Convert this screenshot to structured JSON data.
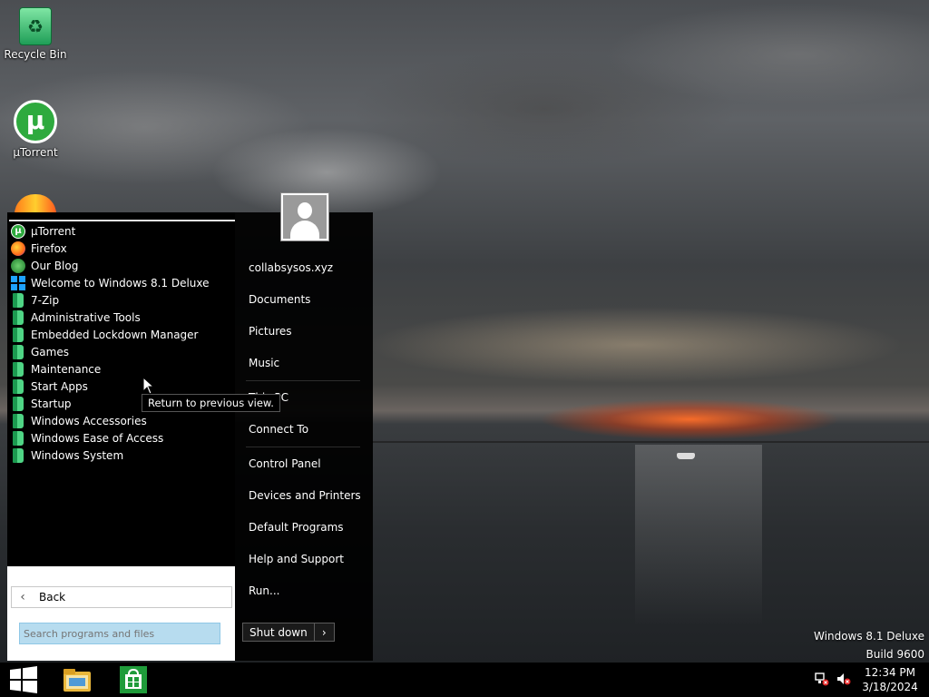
{
  "desktop": {
    "icons": [
      {
        "label": "Recycle Bin",
        "icon": "recycle-bin-icon"
      },
      {
        "label": "µTorrent",
        "icon": "utorrent-icon"
      },
      {
        "label": "",
        "icon": "firefox-icon"
      }
    ],
    "watermark": {
      "line1": "Windows 8.1 Deluxe",
      "line2": "Build 9600"
    }
  },
  "start_menu": {
    "programs": [
      {
        "label": "µTorrent",
        "icon": "utorrent-icon"
      },
      {
        "label": "Firefox",
        "icon": "firefox-icon"
      },
      {
        "label": "Our Blog",
        "icon": "blog-icon"
      },
      {
        "label": "Welcome to Windows 8.1 Deluxe",
        "icon": "windows-icon"
      },
      {
        "label": "7-Zip",
        "icon": "folder-icon"
      },
      {
        "label": "Administrative Tools",
        "icon": "folder-icon"
      },
      {
        "label": "Embedded Lockdown Manager",
        "icon": "folder-icon"
      },
      {
        "label": "Games",
        "icon": "folder-icon"
      },
      {
        "label": "Maintenance",
        "icon": "folder-icon"
      },
      {
        "label": "Start Apps",
        "icon": "folder-icon"
      },
      {
        "label": "Startup",
        "icon": "folder-icon"
      },
      {
        "label": "Windows Accessories",
        "icon": "folder-icon"
      },
      {
        "label": "Windows Ease of Access",
        "icon": "folder-icon"
      },
      {
        "label": "Windows System",
        "icon": "folder-icon"
      }
    ],
    "back_label": "Back",
    "back_tooltip": "Return to previous view.",
    "search": {
      "placeholder": "Search programs and files",
      "value": ""
    },
    "user": {
      "name": "collabsysos.xyz",
      "avatar": "user-avatar-icon"
    },
    "places": [
      {
        "label": "Documents"
      },
      {
        "label": "Pictures"
      },
      {
        "label": "Music"
      },
      {
        "label": "This PC"
      },
      {
        "label": "Connect To"
      },
      {
        "label": "Control Panel"
      },
      {
        "label": "Devices and Printers"
      },
      {
        "label": "Default Programs"
      },
      {
        "label": "Help and Support"
      },
      {
        "label": "Run..."
      }
    ],
    "shutdown_label": "Shut down",
    "shutdown_arrow": "›"
  },
  "taskbar": {
    "start_icon": "windows-logo-icon",
    "pinned": [
      {
        "name": "file-explorer-icon"
      },
      {
        "name": "store-icon"
      }
    ],
    "tray": [
      {
        "name": "network-disconnected-icon"
      },
      {
        "name": "volume-muted-icon"
      }
    ],
    "clock": {
      "time": "12:34 PM",
      "date": "3/18/2024"
    }
  },
  "colors": {
    "accent_green": "#2eaa3e",
    "start_menu_bg": "#000000",
    "search_bg": "#b7dcef",
    "windows_blue": "#1ea2ff"
  }
}
